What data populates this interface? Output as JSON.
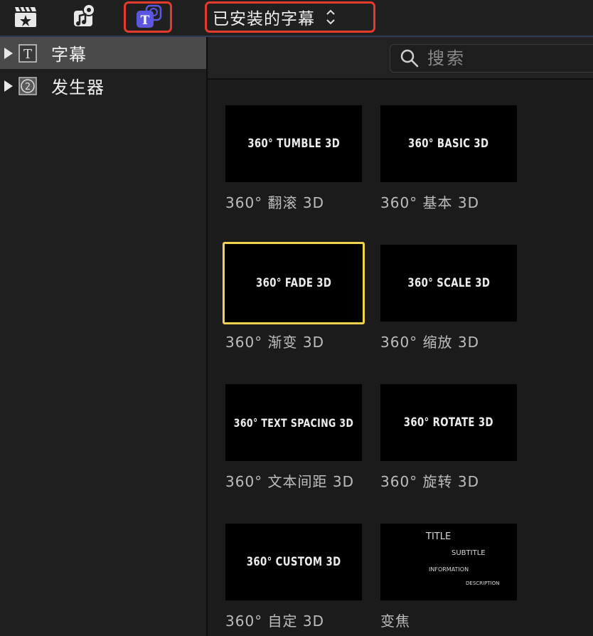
{
  "toolbar": {
    "dropdown_label": "已安装的字幕",
    "title_icon_letter": "T"
  },
  "sidebar": {
    "items": [
      {
        "label": "字幕",
        "icon_glyph": "T",
        "selected": true
      },
      {
        "label": "发生器",
        "icon_glyph": "2",
        "selected": false
      }
    ]
  },
  "search": {
    "placeholder": "搜索"
  },
  "browser": {
    "items": [
      {
        "thumb_text": "360° TUMBLE 3D",
        "name": "360° 翻滚 3D",
        "selected": false
      },
      {
        "thumb_text": "360° BASIC 3D",
        "name": "360° 基本 3D",
        "selected": false
      },
      {
        "thumb_text": "360° FADE 3D",
        "name": "360° 渐变 3D",
        "selected": true
      },
      {
        "thumb_text": "360° SCALE 3D",
        "name": "360° 缩放 3D",
        "selected": false
      },
      {
        "thumb_text": "360° TEXT SPACING 3D",
        "name": "360° 文本间距 3D",
        "selected": false
      },
      {
        "thumb_text": "360° ROTATE 3D",
        "name": "360° 旋转 3D",
        "selected": false
      },
      {
        "thumb_text": "360° CUSTOM 3D",
        "name": "360° 自定 3D",
        "selected": false
      },
      {
        "zoom_lines": [
          "TITLE",
          "SUBTITLE",
          "INFORMATION",
          "DESCRIPTION"
        ],
        "name": "变焦",
        "selected": false
      }
    ]
  },
  "colors": {
    "highlight_red": "#e53b2e",
    "selection_yellow": "#f2d24c",
    "titles_purple": "#5b57e0"
  }
}
